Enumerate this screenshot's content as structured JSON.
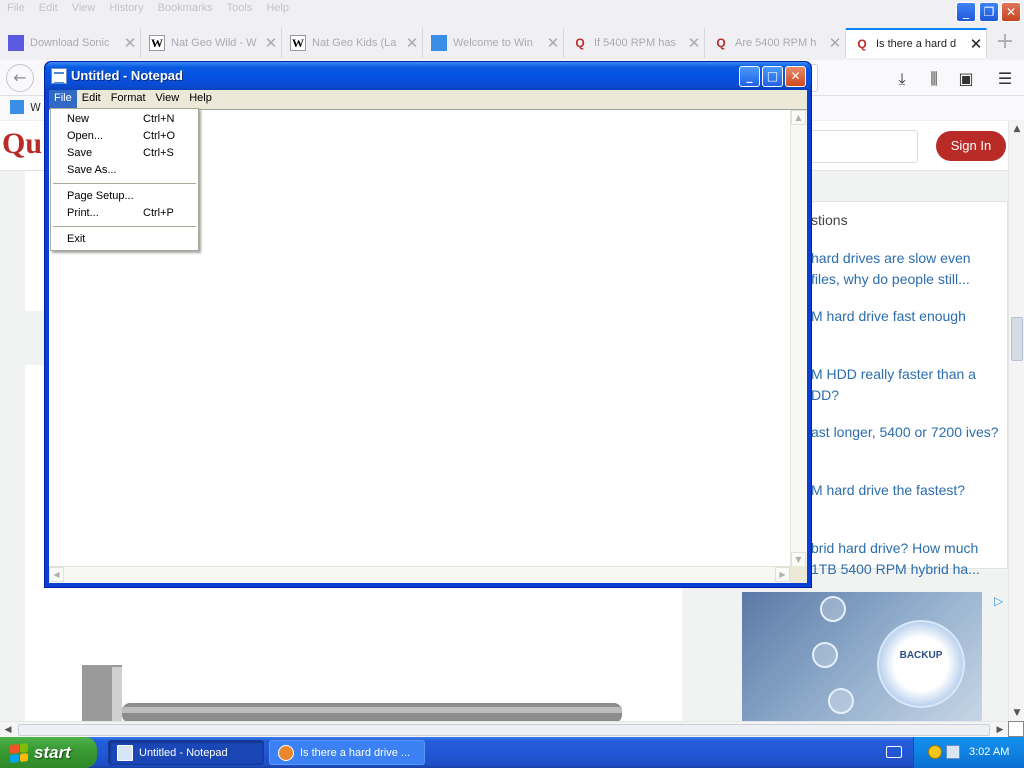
{
  "firefox": {
    "menu": [
      "File",
      "Edit",
      "View",
      "History",
      "Bookmarks",
      "Tools",
      "Help"
    ],
    "tabs": [
      {
        "title": "Download Sonic",
        "icon": "sonic-favicon",
        "color": "#5a5ae0",
        "active": false
      },
      {
        "title": "Nat Geo Wild - W",
        "icon": "wikipedia-favicon",
        "color": "#333333",
        "active": false
      },
      {
        "title": "Nat Geo Kids (La",
        "icon": "wikipedia-favicon",
        "color": "#333333",
        "active": false
      },
      {
        "title": "Welcome to Win",
        "icon": "windows-favicon",
        "color": "#3a8ee6",
        "active": false
      },
      {
        "title": "If 5400 RPM has",
        "icon": "quora-favicon",
        "color": "#b92b27",
        "active": false
      },
      {
        "title": "Are 5400 RPM h",
        "icon": "quora-favicon",
        "color": "#b92b27",
        "active": false
      },
      {
        "title": "Is there a hard d",
        "icon": "quora-favicon",
        "color": "#b92b27",
        "active": true
      }
    ],
    "new_tab_glyph": "+",
    "bookmark_label": "W",
    "page": {
      "logo": "Qu",
      "sign_in": "Sign In",
      "related_title": "stions",
      "related": [
        "hard drives are slow even files, why do people still...",
        "M hard drive fast enough",
        "M HDD really faster than a DD?",
        "ast longer, 5400 or 7200 ives?",
        "M hard drive the fastest?",
        "brid hard drive? How much 1TB 5400 RPM hybrid ha..."
      ],
      "ad_text": "BACKUP"
    }
  },
  "notepad": {
    "title": "Untitled - Notepad",
    "menus": [
      "File",
      "Edit",
      "Format",
      "View",
      "Help"
    ],
    "open_menu": "File",
    "file_menu": [
      {
        "label": "New",
        "shortcut": "Ctrl+N"
      },
      {
        "label": "Open...",
        "shortcut": "Ctrl+O"
      },
      {
        "label": "Save",
        "shortcut": "Ctrl+S"
      },
      {
        "label": "Save As...",
        "shortcut": ""
      },
      {
        "separator": true
      },
      {
        "label": "Page Setup...",
        "shortcut": ""
      },
      {
        "label": "Print...",
        "shortcut": "Ctrl+P"
      },
      {
        "separator": true
      },
      {
        "label": "Exit",
        "shortcut": ""
      }
    ]
  },
  "taskbar": {
    "start_label": "start",
    "tasks": [
      {
        "label": "Untitled - Notepad",
        "icon": "notepad-icon",
        "active": true
      },
      {
        "label": "Is there a hard drive ...",
        "icon": "firefox-icon",
        "active": false
      }
    ],
    "clock": "3:02 AM"
  },
  "colors": {
    "quora_red": "#b92b27",
    "xp_blue": "#0a3fd6",
    "xp_green": "#3a9a33",
    "link_blue": "#2b6dad"
  }
}
